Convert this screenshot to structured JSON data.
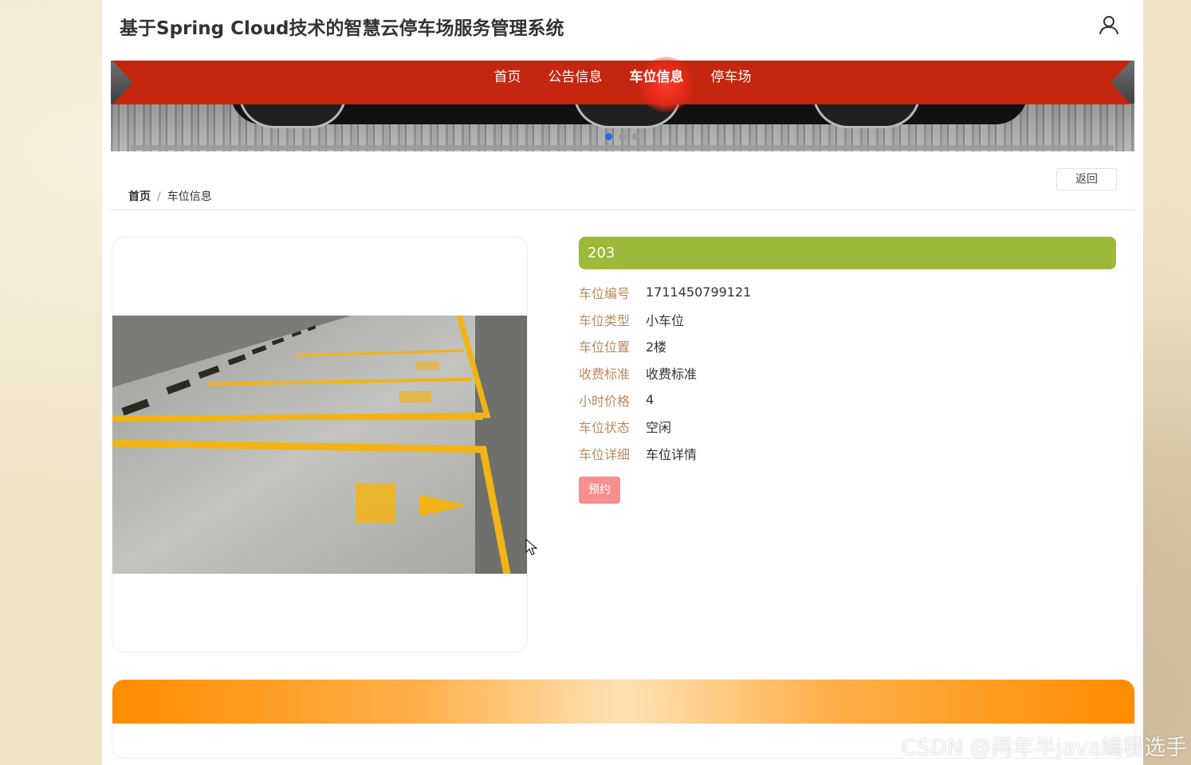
{
  "header": {
    "site_title": "基于Spring Cloud技术的智慧云停车场服务管理系统"
  },
  "nav": {
    "items": [
      "首页",
      "公告信息",
      "车位信息",
      "停车场"
    ],
    "active_index": 2
  },
  "carousel": {
    "slide_count": 3,
    "active_slide": 1
  },
  "breadcrumb": {
    "home": "首页",
    "separator": "/",
    "current": "车位信息"
  },
  "back_button": "返回",
  "detail": {
    "title": "203",
    "fields": [
      {
        "label": "车位编号",
        "value": "1711450799121"
      },
      {
        "label": "车位类型",
        "value": "小车位"
      },
      {
        "label": "车位位置",
        "value": "2楼"
      },
      {
        "label": "收费标准",
        "value": "收费标准"
      },
      {
        "label": "小时价格",
        "value": "4"
      },
      {
        "label": "车位状态",
        "value": "空闲"
      },
      {
        "label": "车位详细",
        "value": "车位详情"
      }
    ],
    "reserve_button": "预约"
  },
  "colors": {
    "nav_red": "#c4260f",
    "title_green": "#9cb93a",
    "label_brown": "#b88a5e",
    "reserve_pink": "#f88f8f",
    "band_orange": "#ff8c00"
  },
  "watermark": "CSDN @两年半java编程选手"
}
